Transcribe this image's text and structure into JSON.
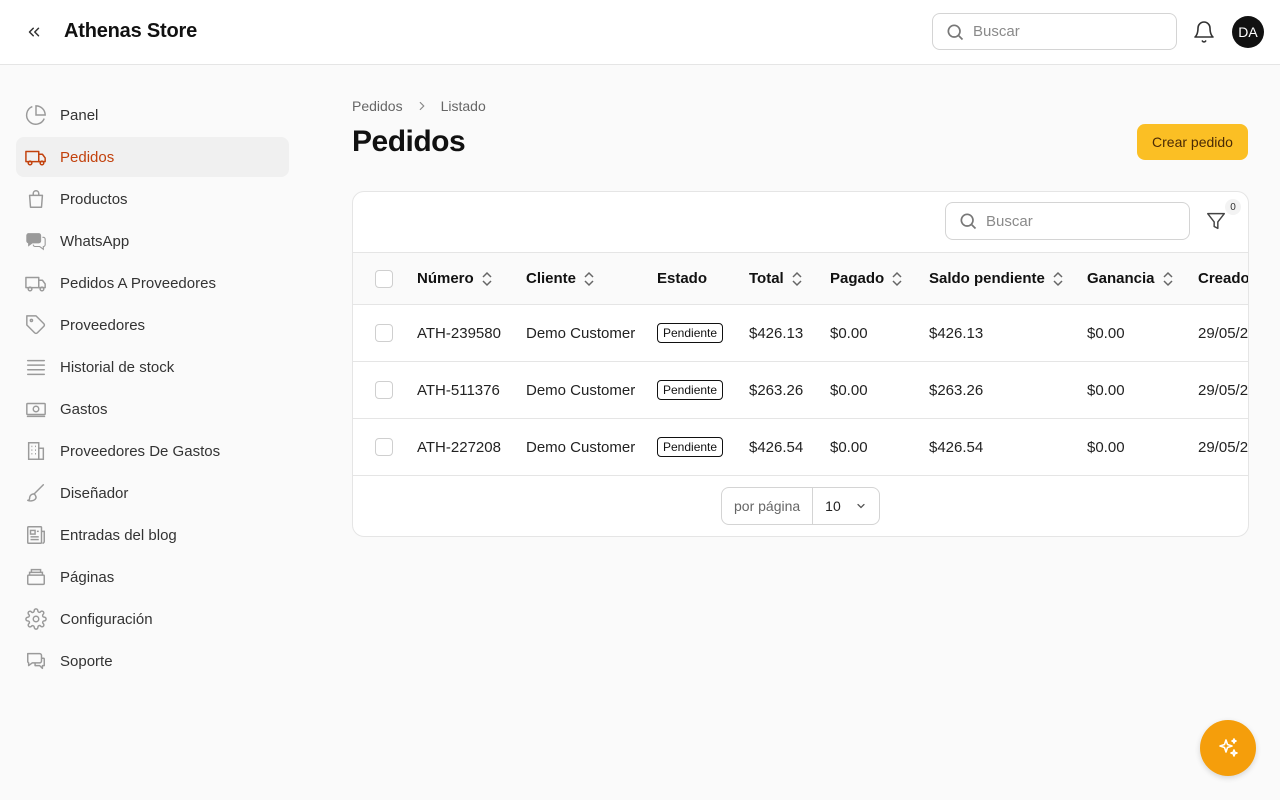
{
  "header": {
    "title": "Athenas Store",
    "search_placeholder": "Buscar",
    "avatar_initials": "DA"
  },
  "sidebar": {
    "items": [
      {
        "label": "Panel",
        "icon": "pie-chart-icon"
      },
      {
        "label": "Pedidos",
        "icon": "truck-icon",
        "active": true
      },
      {
        "label": "Productos",
        "icon": "shopping-bag-icon"
      },
      {
        "label": "WhatsApp",
        "icon": "chat-bubbles-icon"
      },
      {
        "label": "Pedidos A Proveedores",
        "icon": "truck-outline-icon"
      },
      {
        "label": "Proveedores",
        "icon": "tag-icon"
      },
      {
        "label": "Historial de stock",
        "icon": "stack-icon"
      },
      {
        "label": "Gastos",
        "icon": "banknote-icon"
      },
      {
        "label": "Proveedores De Gastos",
        "icon": "building-icon"
      },
      {
        "label": "Diseñador",
        "icon": "paintbrush-icon"
      },
      {
        "label": "Entradas del blog",
        "icon": "newspaper-icon"
      },
      {
        "label": "Páginas",
        "icon": "layers-icon"
      },
      {
        "label": "Configuración",
        "icon": "gear-icon"
      },
      {
        "label": "Soporte",
        "icon": "support-chat-icon"
      }
    ]
  },
  "breadcrumb": {
    "root": "Pedidos",
    "current": "Listado"
  },
  "page": {
    "title": "Pedidos",
    "create_label": "Crear pedido"
  },
  "table": {
    "search_placeholder": "Buscar",
    "filter_count": "0",
    "columns": [
      "Número",
      "Cliente",
      "Estado",
      "Total",
      "Pagado",
      "Saldo pendiente",
      "Ganancia",
      "Creado"
    ],
    "rows": [
      {
        "numero": "ATH-239580",
        "cliente": "Demo Customer",
        "estado": "Pendiente",
        "total": "$426.13",
        "pagado": "$0.00",
        "saldo": "$426.13",
        "ganancia": "$0.00",
        "creado": "29/05/2"
      },
      {
        "numero": "ATH-511376",
        "cliente": "Demo Customer",
        "estado": "Pendiente",
        "total": "$263.26",
        "pagado": "$0.00",
        "saldo": "$263.26",
        "ganancia": "$0.00",
        "creado": "29/05/2"
      },
      {
        "numero": "ATH-227208",
        "cliente": "Demo Customer",
        "estado": "Pendiente",
        "total": "$426.54",
        "pagado": "$0.00",
        "saldo": "$426.54",
        "ganancia": "$0.00",
        "creado": "29/05/2"
      }
    ],
    "per_page_label": "por página",
    "per_page_value": "10"
  },
  "colors": {
    "accent": "#c2410c",
    "primary_button": "#fbbf24",
    "fab": "#f59e0b"
  }
}
